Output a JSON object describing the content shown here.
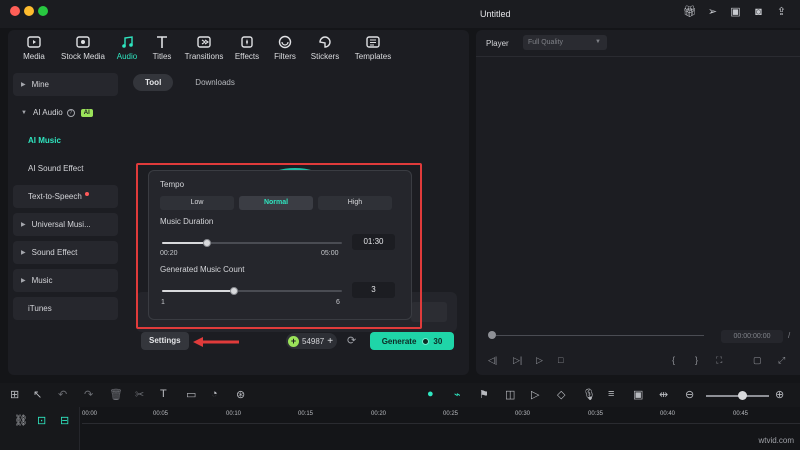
{
  "window": {
    "title": "Untitled",
    "traffic_colors": [
      "#ff5f57",
      "#febc2e",
      "#28c840"
    ]
  },
  "tabs": [
    {
      "label": "Media",
      "icon": "media-icon"
    },
    {
      "label": "Stock Media",
      "icon": "stock-media-icon"
    },
    {
      "label": "Audio",
      "icon": "audio-icon",
      "active": true
    },
    {
      "label": "Titles",
      "icon": "titles-icon"
    },
    {
      "label": "Transitions",
      "icon": "transitions-icon"
    },
    {
      "label": "Effects",
      "icon": "effects-icon"
    },
    {
      "label": "Filters",
      "icon": "filters-icon"
    },
    {
      "label": "Stickers",
      "icon": "stickers-icon"
    },
    {
      "label": "Templates",
      "icon": "templates-icon"
    }
  ],
  "sidebar": {
    "items": [
      {
        "label": "Mine"
      },
      {
        "label": "AI Audio",
        "badge": "AI"
      },
      {
        "label": "AI Music",
        "active": true
      },
      {
        "label": "AI Sound Effect"
      },
      {
        "label": "Text-to-Speech"
      },
      {
        "label": "Universal Musi..."
      },
      {
        "label": "Sound Effect"
      },
      {
        "label": "Music"
      },
      {
        "label": "iTunes"
      }
    ]
  },
  "subtabs": {
    "tool": "Tool",
    "downloads": "Downloads"
  },
  "popup": {
    "tempo_label": "Tempo",
    "tempo_options": [
      "Low",
      "Normal",
      "High"
    ],
    "tempo_selected": "Normal",
    "duration_label": "Music Duration",
    "duration_value": "01:30",
    "duration_min": "00:20",
    "duration_max": "05:00",
    "duration_fraction": 0.25,
    "count_label": "Generated Music Count",
    "count_value": "3",
    "count_min": "1",
    "count_max": "6",
    "count_fraction": 0.4
  },
  "bottom": {
    "settings": "Settings",
    "credits": "54987",
    "generate": "Generate",
    "generate_cost": "30"
  },
  "player": {
    "label": "Player",
    "quality": "Full Quality",
    "timecode": "00:00:00:00",
    "timecode_sep": "/"
  },
  "timeline": {
    "ticks": [
      "00:00",
      "00:05",
      "00:10",
      "00:15",
      "00:20",
      "00:25",
      "00:30",
      "00:35",
      "00:40",
      "00:45"
    ],
    "zoom_fraction": 0.5
  },
  "watermark": "wtvid.com",
  "colors": {
    "accent": "#2fe6c0",
    "generate": "#1fd5a8",
    "highlight": "#e03b3b",
    "ai_badge": "#9be35a"
  }
}
